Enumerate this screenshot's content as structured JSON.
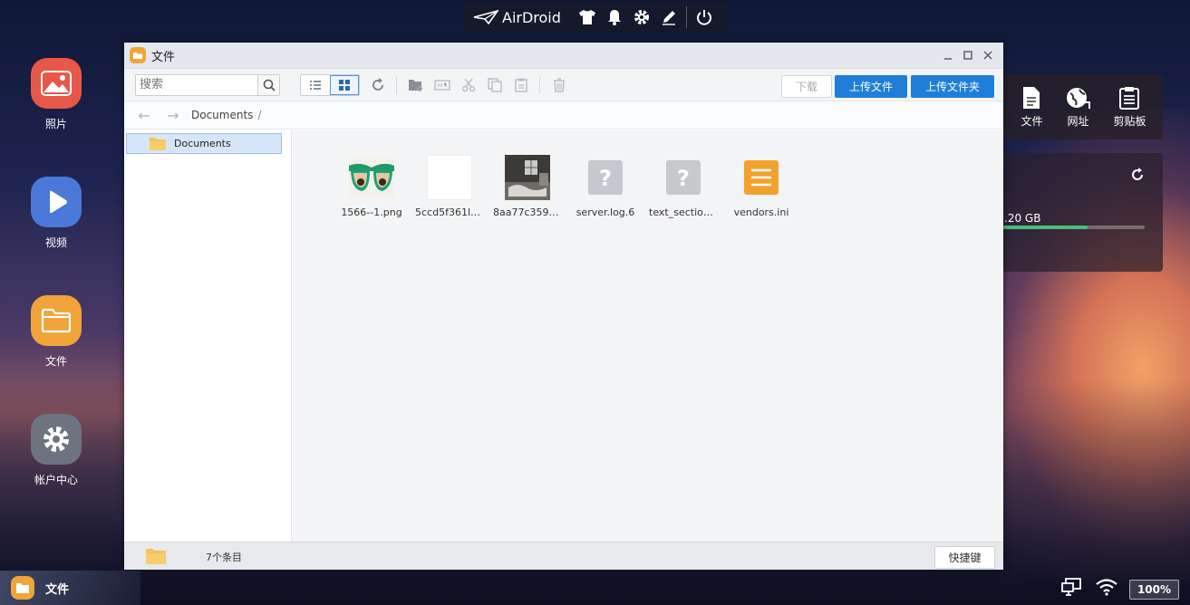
{
  "topbar": {
    "brand": "AirDroid",
    "icons": [
      "shirt-icon",
      "bell-icon",
      "gear-icon",
      "pen-icon",
      "power-icon"
    ]
  },
  "desktop": {
    "icons": [
      {
        "label": "照片",
        "icon": "photo-icon",
        "color": "#e8584a"
      },
      {
        "label": "视频",
        "icon": "play-icon",
        "color": "#4a78d8"
      },
      {
        "label": "文件",
        "icon": "folder-icon",
        "color": "#f0a43a"
      },
      {
        "label": "帐户中心",
        "icon": "gear-icon",
        "color": "#6d7480"
      }
    ]
  },
  "widgets": {
    "quick": [
      {
        "label": "文件",
        "icon": "document-icon"
      },
      {
        "label": "网址",
        "icon": "globe-icon"
      },
      {
        "label": "剪贴板",
        "icon": "clipboard-icon"
      }
    ],
    "storage": {
      "size_text": ".20 GB",
      "used_fraction": 0.6
    }
  },
  "window": {
    "title": "文件",
    "search": {
      "placeholder": "搜索",
      "value": ""
    },
    "download_label": "下载",
    "upload_file_label": "上传文件",
    "upload_folder_label": "上传文件夹",
    "path": {
      "segment": "Documents",
      "separator": "/"
    },
    "tree": {
      "selected": "Documents"
    },
    "files": [
      {
        "name": "1566--1.png",
        "kind": "image-glasses"
      },
      {
        "name": "5ccd5f361l1...",
        "kind": "image-blank"
      },
      {
        "name": "8aa77c359v...",
        "kind": "image-room"
      },
      {
        "name": "server.log.6",
        "kind": "unknown"
      },
      {
        "name": "text_section...",
        "kind": "unknown"
      },
      {
        "name": "vendors.ini",
        "kind": "text"
      }
    ],
    "status": {
      "count": "7个条目",
      "shortcut_label": "快捷键"
    }
  },
  "taskbar": {
    "active_label": "文件",
    "battery": "100%"
  }
}
